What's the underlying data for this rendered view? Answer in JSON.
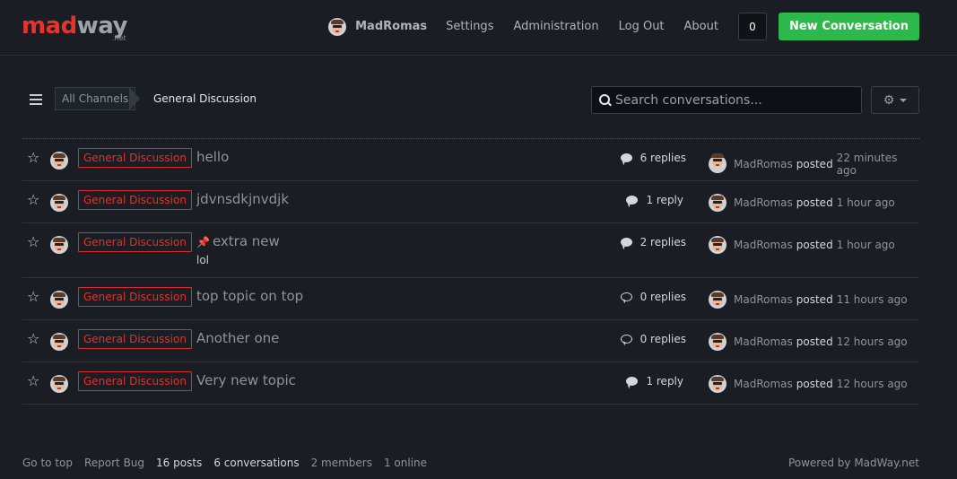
{
  "brand": {
    "name_part1": "mad",
    "name_part2": "way",
    "suffix": ".net",
    "colors": {
      "accent_red": "#e8332c",
      "accent_green": "#2db84c"
    }
  },
  "header": {
    "username": "MadRomas",
    "nav_links": [
      "Settings",
      "Administration",
      "Log Out",
      "About"
    ],
    "notification_count": "0",
    "new_conversation_label": "New Conversation"
  },
  "toolbar": {
    "breadcrumb_all": "All Channels",
    "breadcrumb_current": "General Discussion",
    "search_placeholder": "Search conversations...",
    "menu_icon": "list-icon",
    "settings_icon": "gear-icon"
  },
  "conversations": [
    {
      "channel": "General Discussion",
      "title": "hello",
      "pinned": false,
      "excerpt": "",
      "replies": "6 replies",
      "reply_icon": "filled",
      "last_user": "MadRomas",
      "posted": "posted",
      "time": "22 minutes ago"
    },
    {
      "channel": "General Discussion",
      "title": "jdvnsdkjnvdjk",
      "pinned": false,
      "excerpt": "",
      "replies": "1 reply",
      "reply_icon": "filled",
      "last_user": "MadRomas",
      "posted": "posted",
      "time": "1 hour ago"
    },
    {
      "channel": "General Discussion",
      "title": "extra new",
      "pinned": true,
      "excerpt": "lol",
      "replies": "2 replies",
      "reply_icon": "filled",
      "last_user": "MadRomas",
      "posted": "posted",
      "time": "1 hour ago"
    },
    {
      "channel": "General Discussion",
      "title": "top topic on top",
      "pinned": false,
      "excerpt": "",
      "replies": "0 replies",
      "reply_icon": "outline",
      "last_user": "MadRomas",
      "posted": "posted",
      "time": "11 hours ago"
    },
    {
      "channel": "General Discussion",
      "title": "Another one",
      "pinned": false,
      "excerpt": "",
      "replies": "0 replies",
      "reply_icon": "outline",
      "last_user": "MadRomas",
      "posted": "posted",
      "time": "12 hours ago"
    },
    {
      "channel": "General Discussion",
      "title": "Very new topic",
      "pinned": false,
      "excerpt": "",
      "replies": "1 reply",
      "reply_icon": "filled",
      "last_user": "MadRomas",
      "posted": "posted",
      "time": "12 hours ago"
    }
  ],
  "footer": {
    "go_to_top": "Go to top",
    "report_bug": "Report Bug",
    "posts": "16 posts",
    "conversations": "6 conversations",
    "members": "2 members",
    "online": "1 online",
    "powered_by": "Powered by MadWay.net"
  }
}
